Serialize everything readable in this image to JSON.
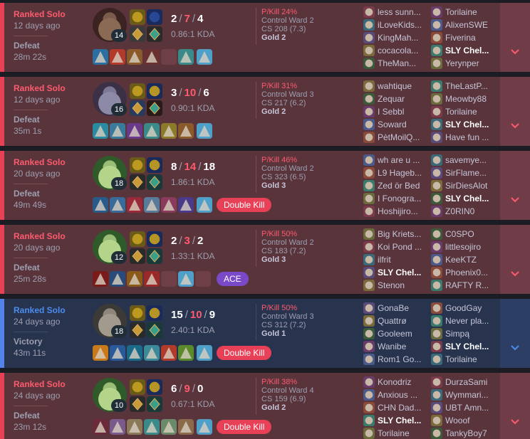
{
  "colors": {
    "loss_bg": "#59343b",
    "win_bg": "#28344e",
    "loss_accent": "#e84057",
    "win_accent": "#5383e8"
  },
  "matches": [
    {
      "queue": "Ranked Solo",
      "ago": "12 days ago",
      "result": "Defeat",
      "duration": "28m 22s",
      "level": "14",
      "kills": "2",
      "deaths": "7",
      "assists": "4",
      "kda": "0.86:1 KDA",
      "pkill": "P/Kill 24%",
      "ward": "Control Ward 2",
      "cs": "CS 208 (7.3)",
      "gold": "Gold 2",
      "badge": "",
      "team1": [
        "less sunn...",
        "iLoveKids...",
        "KingMah...",
        "cocacola...",
        "TheMan..."
      ],
      "team2": [
        "Torilaine",
        "AlixenSWE",
        "Fiverina",
        "SLY Chel...",
        "Yerynper"
      ]
    },
    {
      "queue": "Ranked Solo",
      "ago": "12 days ago",
      "result": "Defeat",
      "duration": "35m 1s",
      "level": "16",
      "kills": "3",
      "deaths": "10",
      "assists": "6",
      "kda": "0.90:1 KDA",
      "pkill": "P/Kill 31%",
      "ward": "Control Ward 3",
      "cs": "CS 217 (6.2)",
      "gold": "Gold 2",
      "badge": "",
      "team1": [
        "wahtique",
        "Zequar",
        "I Sebbl",
        "Soward",
        "PètMoilQ..."
      ],
      "team2": [
        "TheLastP...",
        "Meowby88",
        "Torilaine",
        "SLY Chel...",
        "Have fun ..."
      ]
    },
    {
      "queue": "Ranked Solo",
      "ago": "20 days ago",
      "result": "Defeat",
      "duration": "49m 49s",
      "level": "18",
      "kills": "8",
      "deaths": "14",
      "assists": "18",
      "kda": "1.86:1 KDA",
      "pkill": "P/Kill 46%",
      "ward": "Control Ward 2",
      "cs": "CS 323 (6.5)",
      "gold": "Gold 3",
      "badge": "Double Kill",
      "team1": [
        "wh are u ...",
        "L9 Hageb...",
        "Zed ör Bed",
        "I Fonogra...",
        "Hoshijiro..."
      ],
      "team2": [
        "savemye...",
        "SirFlame...",
        "SirDiesAlot",
        "SLY Chel...",
        "Z0RIN0"
      ]
    },
    {
      "queue": "Ranked Solo",
      "ago": "20 days ago",
      "result": "Defeat",
      "duration": "25m 28s",
      "level": "12",
      "kills": "2",
      "deaths": "3",
      "assists": "2",
      "kda": "1.33:1 KDA",
      "pkill": "P/Kill 50%",
      "ward": "Control Ward 2",
      "cs": "CS 183 (7.2)",
      "gold": "Gold 3",
      "badge": "ACE",
      "team1": [
        "Big Kriets...",
        "Koi Pond ...",
        "ilfrit",
        "SLY Chel...",
        "Stenon"
      ],
      "team2": [
        "C0SPO",
        "littlesojiro",
        "KeeKTZ",
        "Phoenix0...",
        "RAFTY R..."
      ]
    },
    {
      "queue": "Ranked Solo",
      "ago": "24 days ago",
      "result": "Victory",
      "duration": "43m 11s",
      "level": "18",
      "kills": "15",
      "deaths": "10",
      "assists": "9",
      "kda": "2.40:1 KDA",
      "pkill": "P/Kill 50%",
      "ward": "Control Ward 3",
      "cs": "CS 312 (7.2)",
      "gold": "Gold 1",
      "badge": "Double Kill",
      "team1": [
        "GonaBe",
        "Quattrø",
        "Gooleem",
        "Wanibe",
        "Rom1 Go..."
      ],
      "team2": [
        "GoodGay",
        "Never pla...",
        "Simpą",
        "SLY Chel...",
        "Torilaine"
      ]
    },
    {
      "queue": "Ranked Solo",
      "ago": "24 days ago",
      "result": "Defeat",
      "duration": "23m 12s",
      "level": "10",
      "kills": "6",
      "deaths": "9",
      "assists": "0",
      "kda": "0.67:1 KDA",
      "pkill": "P/Kill 38%",
      "ward": "Control Ward 4",
      "cs": "CS 159 (6.9)",
      "gold": "Gold 2",
      "badge": "Double Kill",
      "team1": [
        "Konodriz",
        "Anxious ...",
        "CHN Dad...",
        "SLY Chel...",
        "Torilaine"
      ],
      "team2": [
        "DurzaSami",
        "Wymmari...",
        "UBT Amn...",
        "Wooof",
        "TankyBoy7"
      ]
    }
  ]
}
